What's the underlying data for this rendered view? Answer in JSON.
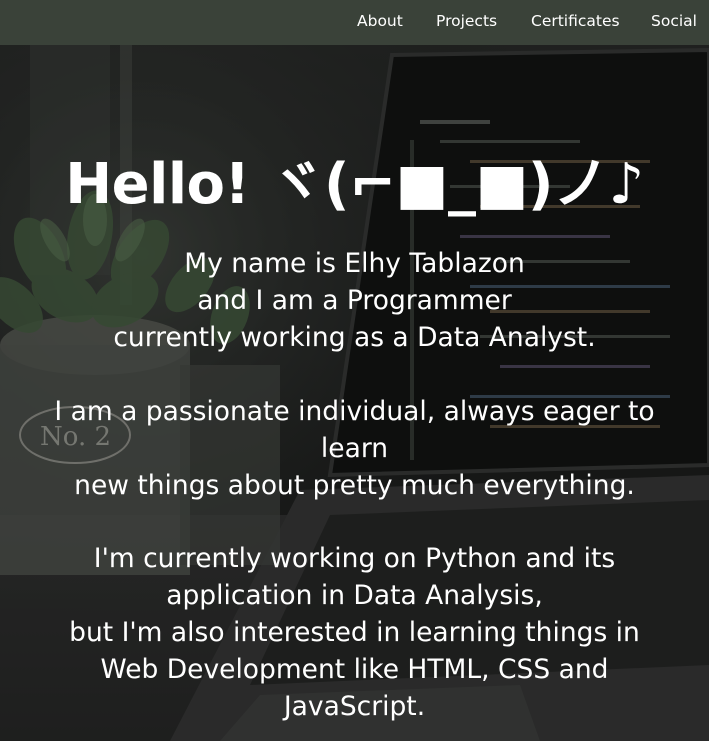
{
  "nav": {
    "about": "About",
    "projects": "Projects",
    "certificates": "Certificates",
    "social": "Social"
  },
  "hero": {
    "title": "Hello! ヾ(⌐■_■)ノ♪",
    "intro": {
      "line1": "My name is Elhy Tablazon",
      "line2": "and I am a Programmer",
      "line3": "currently working as a Data Analyst."
    },
    "passion": {
      "line1": "I am a passionate individual, always eager to",
      "line2": "learn",
      "line3": "new things about pretty much everything."
    },
    "current": {
      "line1": "I'm currently working on Python and its",
      "line2": "application in Data Analysis,",
      "line3": "but I'm also interested in learning things in",
      "line4": "Web Development like HTML, CSS and",
      "line5": "JavaScript."
    }
  },
  "colors": {
    "navbar": "#3a4239",
    "text": "#ffffff"
  },
  "background": {
    "pot_text": "No. 2"
  }
}
